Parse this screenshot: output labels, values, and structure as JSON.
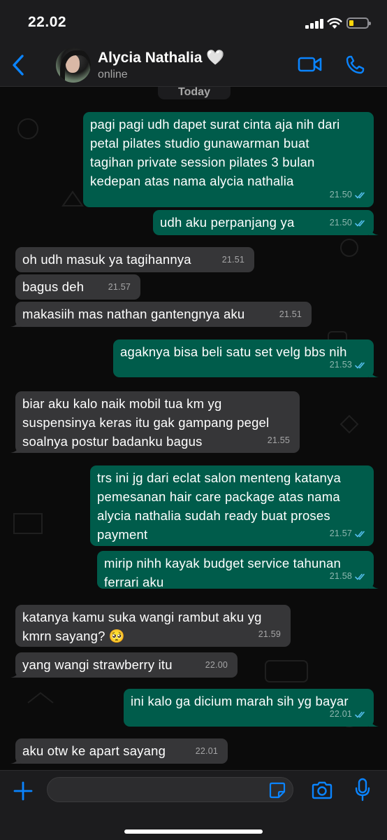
{
  "status_bar": {
    "time": "22.02"
  },
  "header": {
    "contact_name": "Alycia Nathalia 🤍",
    "contact_status": "online"
  },
  "chat": {
    "date_label": "Today",
    "messages": [
      {
        "dir": "out",
        "text": "pagi pagi udh dapet surat cinta aja nih dari\npetal pilates studio gunawarman buat\ntagihan private session pilates 3 bulan\nkedepan atas nama alycia nathalia",
        "time": "21.50",
        "read": true
      },
      {
        "dir": "out",
        "text": "udh aku perpanjang ya",
        "time": "21.50",
        "read": true
      },
      {
        "dir": "in",
        "text": "oh udh masuk ya tagihannya",
        "time": "21.51"
      },
      {
        "dir": "in",
        "text": "bagus deh",
        "time": "21.57"
      },
      {
        "dir": "in",
        "text": "makasiih mas nathan gantengnya aku",
        "time": "21.51"
      },
      {
        "dir": "out",
        "text": "agaknya bisa beli satu set velg bbs nih",
        "time": "21.53",
        "read": true
      },
      {
        "dir": "in",
        "text": "biar aku kalo naik mobil tua km yg\nsuspensinya keras itu gak gampang pegel\nsoalnya postur badanku bagus",
        "time": "21.55"
      },
      {
        "dir": "out",
        "text": "trs ini jg dari eclat salon menteng katanya\npemesanan hair care package atas nama\nalycia nathalia sudah ready buat proses\npayment",
        "time": "21.57",
        "read": true
      },
      {
        "dir": "out",
        "text": "mirip nihh kayak budget service tahunan\nferrari aku",
        "time": "21.58",
        "read": true
      },
      {
        "dir": "in",
        "text": "katanya kamu suka wangi rambut aku yg\nkmrn sayang? 🥺",
        "time": "21.59"
      },
      {
        "dir": "in",
        "text": "yang wangi strawberry itu",
        "time": "22.00"
      },
      {
        "dir": "out",
        "text": "ini kalo ga dicium marah sih yg bayar",
        "time": "22.01",
        "read": true
      },
      {
        "dir": "in",
        "text": "aku otw ke apart sayang",
        "time": "22.01"
      }
    ]
  },
  "input": {
    "placeholder": ""
  },
  "colors": {
    "accent": "#0a84ff",
    "outgoing_bubble": "#005c4b",
    "incoming_bubble": "#363638",
    "read_ticks": "#53bdeb",
    "background": "#0b0b0b"
  },
  "icons": [
    "back-chevron-icon",
    "video-call-icon",
    "phone-icon",
    "plus-icon",
    "sticker-icon",
    "camera-icon",
    "microphone-icon"
  ]
}
